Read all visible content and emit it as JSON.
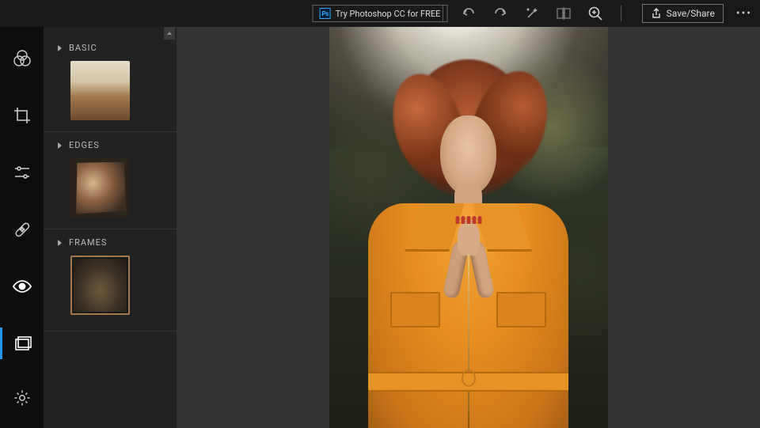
{
  "topbar": {
    "promo_label": "Try Photoshop CC for FREE",
    "save_share_label": "Save/Share"
  },
  "panel": {
    "sections": [
      {
        "label": "BASIC"
      },
      {
        "label": "EDGES"
      },
      {
        "label": "FRAMES"
      }
    ]
  }
}
